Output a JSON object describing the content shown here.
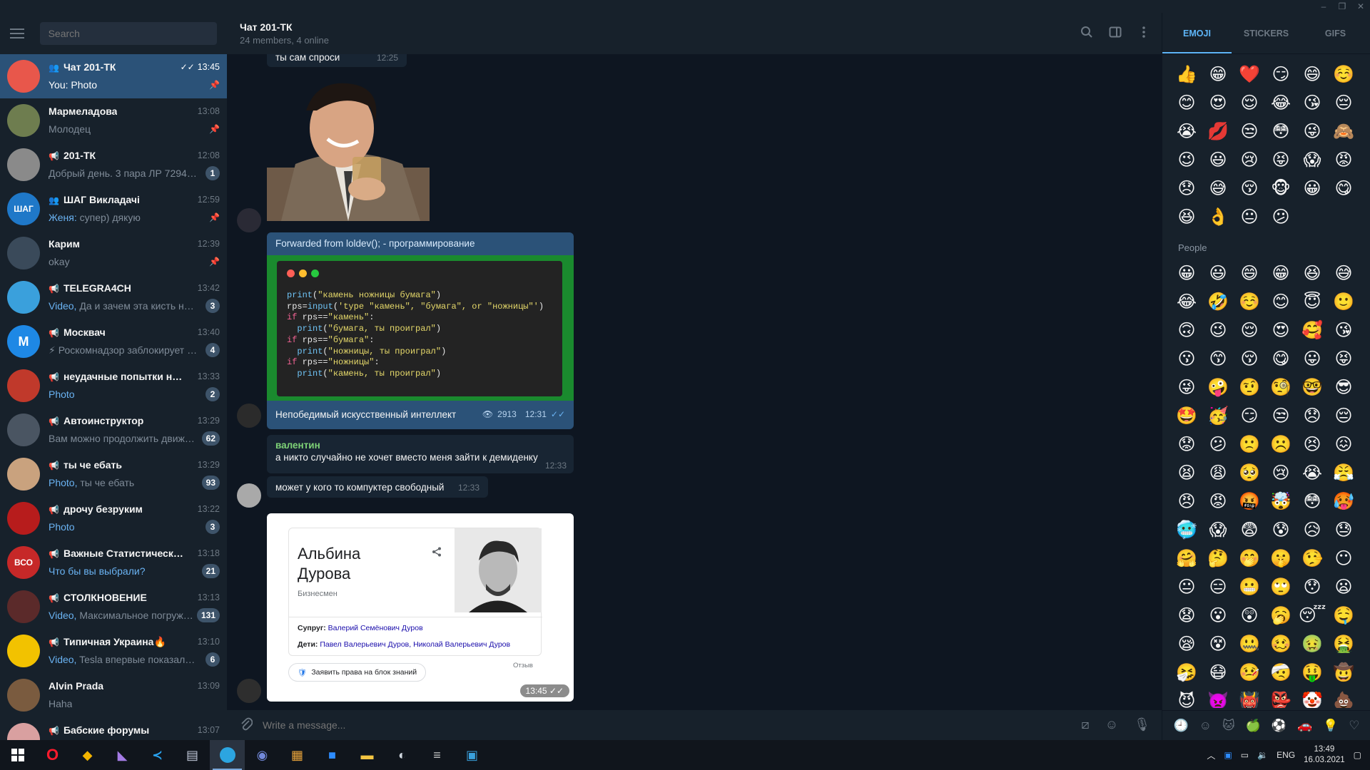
{
  "window": {
    "controls": [
      "–",
      "❐",
      "✕"
    ]
  },
  "sidebar": {
    "search_placeholder": "Search",
    "chats": [
      {
        "name": "Чат 201-ТК",
        "type": "group",
        "time": "13:45",
        "prefix": "You:",
        "preview": "Photo",
        "badge": "",
        "pinned": true,
        "active": true,
        "read": true,
        "avatar_color": "#e8574b",
        "avatar_text": ""
      },
      {
        "name": "Мармеладова",
        "type": "user",
        "time": "13:08",
        "prefix": "",
        "preview": "Молодец",
        "badge": "",
        "pinned": true,
        "avatar_color": "#6e7d4f",
        "avatar_text": ""
      },
      {
        "name": "201-ТК",
        "type": "channel",
        "time": "12:08",
        "prefix": "",
        "preview": "Добрый день. 3 пара ЛР 7294051...",
        "badge": "1",
        "pinned": false,
        "avatar_color": "#8a8a8a",
        "avatar_text": ""
      },
      {
        "name": "ШАГ Викладачі",
        "type": "group",
        "time": "12:59",
        "prefix": "Женя:",
        "preview": "супер) дякую",
        "badge": "",
        "pinned": true,
        "avatar_color": "#1f78c8",
        "avatar_text": "ШАГ"
      },
      {
        "name": "Карим",
        "type": "user",
        "time": "12:39",
        "prefix": "",
        "preview": "okay",
        "badge": "",
        "pinned": true,
        "avatar_color": "#3a4a5a",
        "avatar_text": ""
      },
      {
        "name": "TELEGRA4CH",
        "type": "channel",
        "time": "13:42",
        "prefix": "Video,",
        "preview": "Да и зачем эта кисть нужн...",
        "badge": "3",
        "pinned": false,
        "avatar_color": "#3aa0dc",
        "avatar_text": ""
      },
      {
        "name": "Москвач",
        "type": "channel",
        "time": "13:40",
        "prefix": "",
        "preview": "⚡ Роскомнадзор заблокирует Т...",
        "badge": "4",
        "pinned": false,
        "avatar_color": "#1e88e5",
        "avatar_text": "M"
      },
      {
        "name": "неудачные попытки наеб...",
        "type": "channel",
        "time": "13:33",
        "prefix": "Photo",
        "preview": "",
        "badge": "2",
        "pinned": false,
        "avatar_color": "#c0392b",
        "avatar_text": ""
      },
      {
        "name": "Автоинструктор",
        "type": "channel",
        "time": "13:29",
        "prefix": "",
        "preview": "Вам можно продолжить движе...",
        "badge": "62",
        "pinned": false,
        "avatar_color": "#4a5562",
        "avatar_text": ""
      },
      {
        "name": "ты че ебать",
        "type": "channel",
        "time": "13:29",
        "prefix": "Photo,",
        "preview": "ты че ебать",
        "badge": "93",
        "pinned": false,
        "avatar_color": "#c9a27e",
        "avatar_text": ""
      },
      {
        "name": "дрочу безруким",
        "type": "channel",
        "time": "13:22",
        "prefix": "Photo",
        "preview": "",
        "badge": "3",
        "pinned": false,
        "avatar_color": "#b71c1c",
        "avatar_text": ""
      },
      {
        "name": "Важные Статистические ...",
        "type": "channel",
        "time": "13:18",
        "prefix": "Что бы вы выбрали?",
        "preview": "",
        "badge": "21",
        "pinned": false,
        "avatar_color": "#c62828",
        "avatar_text": "ВСО"
      },
      {
        "name": "СТОЛКНОВЕНИЕ",
        "type": "channel",
        "time": "13:13",
        "prefix": "Video,",
        "preview": "Максимальное погруже...",
        "badge": "131",
        "pinned": false,
        "avatar_color": "#5b2a2a",
        "avatar_text": ""
      },
      {
        "name": "Типичная Украина🔥",
        "type": "channel",
        "time": "13:10",
        "prefix": "Video,",
        "preview": "Tesla впервые показала ис...",
        "badge": "6",
        "pinned": false,
        "avatar_color": "#f2c200",
        "avatar_text": ""
      },
      {
        "name": "Alvin Prada",
        "type": "user",
        "time": "13:09",
        "prefix": "",
        "preview": "Haha",
        "badge": "",
        "pinned": false,
        "avatar_color": "#7a5b3f",
        "avatar_text": ""
      },
      {
        "name": "Бабские форумы",
        "type": "channel",
        "time": "13:07",
        "prefix": "",
        "preview": "",
        "badge": "",
        "pinned": false,
        "avatar_color": "#d9a0a0",
        "avatar_text": ""
      }
    ]
  },
  "header": {
    "title": "Чат 201-ТК",
    "subtitle": "24 members, 4 online"
  },
  "messages": {
    "top_partial": {
      "text": "ты сам спроси",
      "time": "12:25"
    },
    "forward": {
      "from": "Forwarded from loldev(); - программирование",
      "code_lines": [
        [
          [
            "f",
            "print"
          ],
          [
            "p",
            "("
          ],
          [
            "s",
            "\"камень ножницы бумага\""
          ],
          [
            "p",
            ")"
          ]
        ],
        [
          [
            "p",
            "rps="
          ],
          [
            "f",
            "input"
          ],
          [
            "p",
            "("
          ],
          [
            "s",
            "'type \"камень\", \"бумага\", or \"ножницы\"'"
          ],
          [
            "p",
            ")"
          ]
        ],
        [
          [
            "k",
            "if"
          ],
          [
            "p",
            " rps=="
          ],
          [
            "s",
            "\"камень\""
          ],
          [
            "p",
            ":"
          ]
        ],
        [
          [
            "p",
            "  "
          ],
          [
            "f",
            "print"
          ],
          [
            "p",
            "("
          ],
          [
            "s",
            "\"бумага, ты проиграл\""
          ],
          [
            "p",
            ")"
          ]
        ],
        [
          [
            "k",
            "if"
          ],
          [
            "p",
            " rps=="
          ],
          [
            "s",
            "\"бумага\""
          ],
          [
            "p",
            ":"
          ]
        ],
        [
          [
            "p",
            "  "
          ],
          [
            "f",
            "print"
          ],
          [
            "p",
            "("
          ],
          [
            "s",
            "\"ножницы, ты проиграл\""
          ],
          [
            "p",
            ")"
          ]
        ],
        [
          [
            "k",
            "if"
          ],
          [
            "p",
            " rps=="
          ],
          [
            "s",
            "\"ножницы\""
          ],
          [
            "p",
            ":"
          ]
        ],
        [
          [
            "p",
            "  "
          ],
          [
            "f",
            "print"
          ],
          [
            "p",
            "("
          ],
          [
            "s",
            "\"камень, ты проиграл\""
          ],
          [
            "p",
            ")"
          ]
        ]
      ],
      "caption": "Непобедимый искусственный интеллект",
      "views": "2913",
      "time": "12:31"
    },
    "valentin": {
      "author": "валентин",
      "text": "а никто случайно не хочет вместо меня зайти к демиденку",
      "time": "12:33"
    },
    "computer": {
      "text": "может у кого то компуктер свободный",
      "time": "12:33"
    },
    "card": {
      "name_line1": "Альбина",
      "name_line2": "Дурова",
      "role": "Бизнесмен",
      "spouse_label": "Супруг:",
      "spouse": "Валерий Семёнович Дуров",
      "kids_label": "Дети:",
      "kids": "Павел Валерьевич Дуров, Николай Валерьевич Дуров",
      "claim": "Заявить права на блок знаний",
      "feedback": "Отзыв",
      "time": "13:45"
    }
  },
  "composer": {
    "placeholder": "Write a message..."
  },
  "emoji_panel": {
    "tabs": [
      "EMOJI",
      "STICKERS",
      "GIFS"
    ],
    "section_people": "People",
    "recent": [
      "👍",
      "😁",
      "❤️",
      "😏",
      "😄",
      "☺️",
      "😊",
      "😍",
      "😌",
      "😂",
      "😘",
      "😔",
      "😭",
      "💋",
      "😒",
      "😳",
      "😜",
      "🙈",
      "😉",
      "😃",
      "😢",
      "😝",
      "😱",
      "😡",
      "😞",
      "😅",
      "😚",
      "🐵",
      "😀",
      "😋",
      "😆",
      "👌",
      "😐",
      "😕"
    ],
    "people": [
      "😀",
      "😃",
      "😄",
      "😁",
      "😆",
      "😅",
      "😂",
      "🤣",
      "☺️",
      "😊",
      "😇",
      "🙂",
      "🙃",
      "😉",
      "😌",
      "😍",
      "🥰",
      "😘",
      "😗",
      "😙",
      "😚",
      "😋",
      "😛",
      "😝",
      "😜",
      "🤪",
      "🤨",
      "🧐",
      "🤓",
      "😎",
      "🤩",
      "🥳",
      "😏",
      "😒",
      "😞",
      "😔",
      "😟",
      "😕",
      "🙁",
      "☹️",
      "😣",
      "😖",
      "😫",
      "😩",
      "🥺",
      "😢",
      "😭",
      "😤",
      "😠",
      "😡",
      "🤬",
      "🤯",
      "😳",
      "🥵",
      "🥶",
      "😱",
      "😨",
      "😰",
      "😥",
      "😓",
      "🤗",
      "🤔",
      "🤭",
      "🤫",
      "🤥",
      "😶",
      "😐",
      "😑",
      "😬",
      "🙄",
      "😯",
      "😦",
      "😧",
      "😮",
      "😲",
      "🥱",
      "😴",
      "🤤",
      "😪",
      "😵",
      "🤐",
      "🥴",
      "🤢",
      "🤮",
      "🤧",
      "😷",
      "🤒",
      "🤕",
      "🤑",
      "🤠",
      "😈",
      "👿",
      "👹",
      "👺",
      "🤡",
      "💩"
    ],
    "bottom_icons": [
      "🕘",
      "☺",
      "🐱",
      "🍏",
      "⚽",
      "🚗",
      "💡",
      "♡"
    ]
  },
  "taskbar": {
    "apps": [
      "start-icon",
      "opera-icon",
      "git-icon",
      "visual-studio-icon",
      "vscode-icon",
      "terminal-icon",
      "telegram-icon",
      "discord-icon",
      "grid-app-icon",
      "zoom-icon",
      "explorer-icon",
      "app-icon",
      "database-icon",
      "photos-icon"
    ],
    "lang": "ENG",
    "time": "13:49",
    "date": "16.03.2021"
  }
}
